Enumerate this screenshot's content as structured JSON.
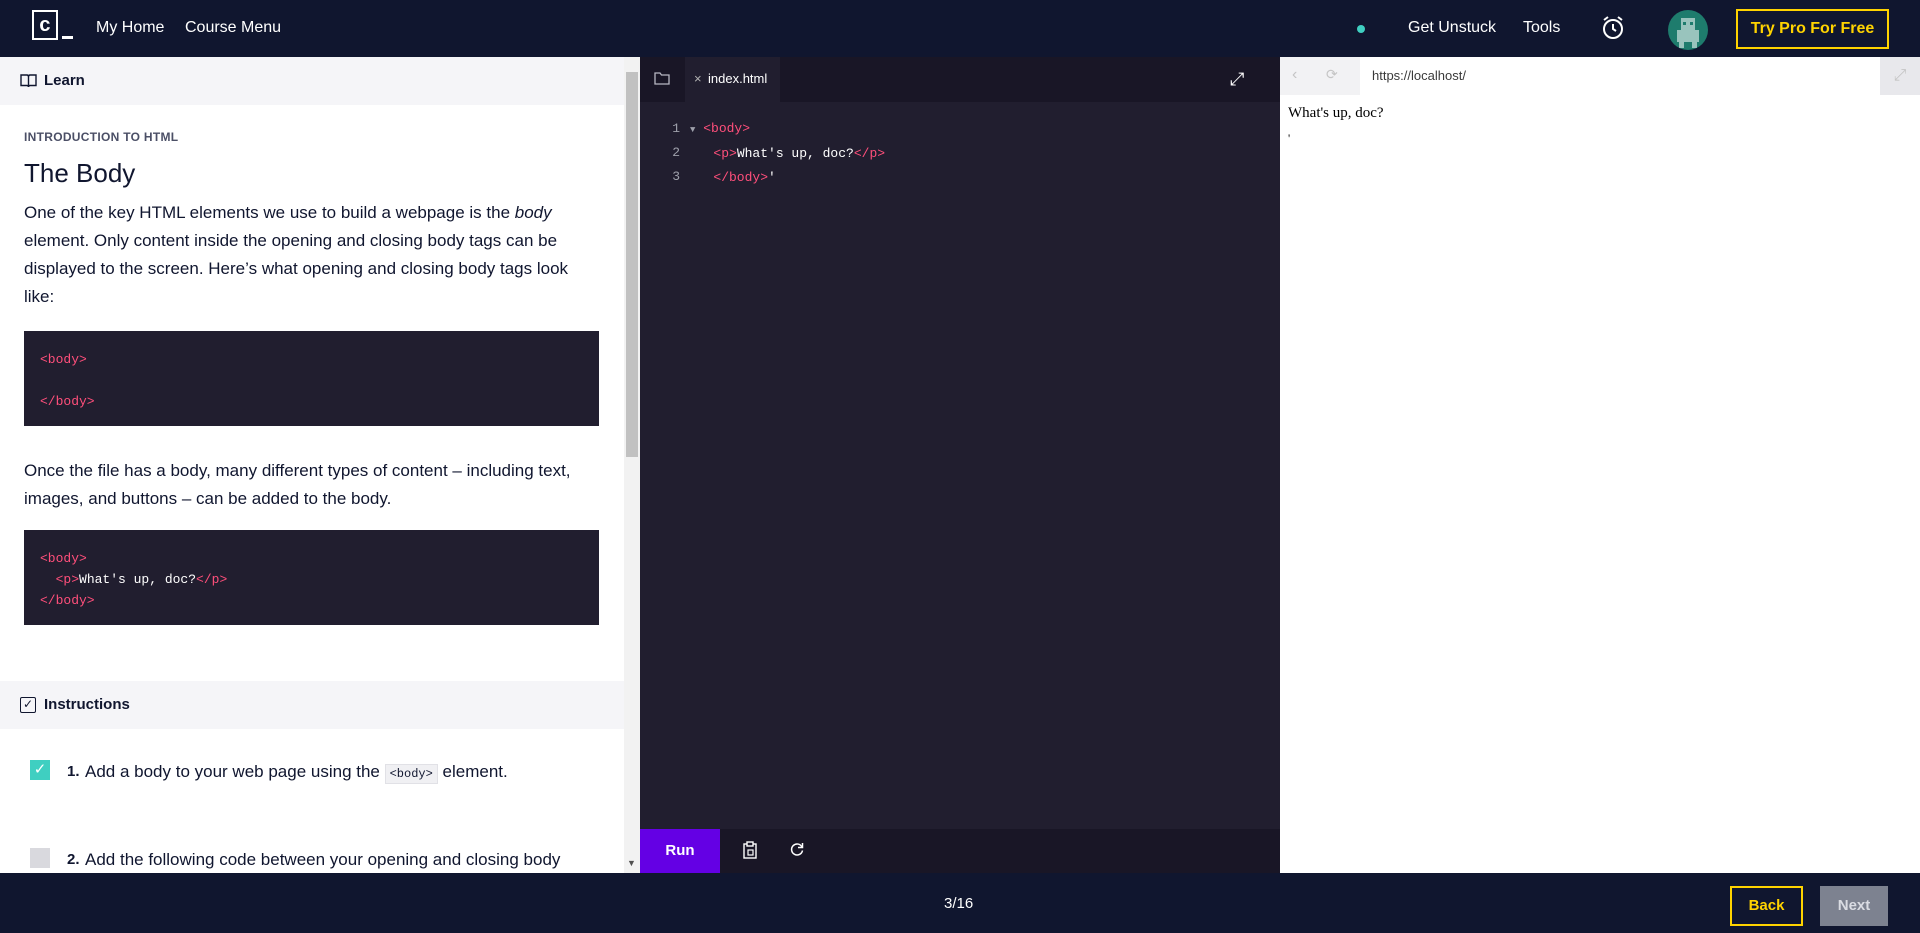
{
  "nav": {
    "logo_letter": "c",
    "my_home": "My Home",
    "course_menu": "Course Menu",
    "get_unstuck": "Get Unstuck",
    "tools": "Tools",
    "try_pro": "Try Pro For Free"
  },
  "learn": {
    "header": "Learn",
    "kicker": "INTRODUCTION TO HTML",
    "title": "The Body",
    "para1_a": "One of the key HTML elements we use to build a webpage is the ",
    "para1_em": "body",
    "para1_b": " element. Only content inside the opening and closing body tags can be displayed to the screen. Here’s what opening and closing body tags look like:",
    "code1_open": "<body>",
    "code1_close": "</body>",
    "para2": "Once the file has a body, many different types of content – including text, images, and buttons – can be added to the body.",
    "code2_open": "<body>",
    "code2_p_open": "<p>",
    "code2_text": "What's up, doc?",
    "code2_p_close": "</p>",
    "code2_close": "</body>"
  },
  "instructions": {
    "header": "Instructions",
    "task1_num": "1.",
    "task1_a": "Add a body to your web page using the ",
    "task1_code": "<body>",
    "task1_b": " element.",
    "task1_done": true,
    "task2_num": "2.",
    "task2": "Add the following code between your opening and closing body",
    "task2_done": false
  },
  "editor": {
    "tab_name": "index.html",
    "line_numbers": [
      "1",
      "2",
      "3"
    ],
    "line1": "<body>",
    "line2_open": "<p>",
    "line2_text": "What's up, doc?",
    "line2_close": "</p>",
    "line3": "</body>",
    "line3_trail": "'",
    "run": "Run"
  },
  "browser": {
    "url": "https://localhost/",
    "output_line1": "What's up, doc?",
    "output_line2": "'"
  },
  "footer": {
    "progress": "3/16",
    "back": "Back",
    "next": "Next"
  },
  "colors": {
    "brand_dark": "#10162f",
    "accent_yellow": "#ffd300",
    "run_purple": "#6400e4",
    "check_teal": "#3fcfc1",
    "tag_pink": "#ff4f7b"
  }
}
